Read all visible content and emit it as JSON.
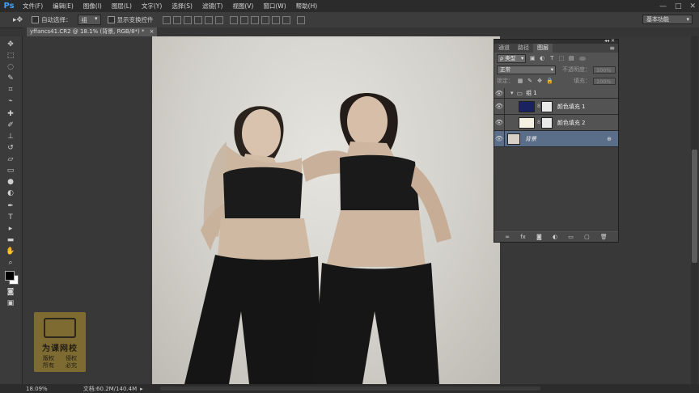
{
  "app": {
    "logo": "Ps"
  },
  "menu": [
    "文件(F)",
    "编辑(E)",
    "图像(I)",
    "图层(L)",
    "文字(Y)",
    "选择(S)",
    "滤镜(T)",
    "视图(V)",
    "窗口(W)",
    "帮助(H)"
  ],
  "window_controls": {
    "minimize": "—",
    "maximize": "□",
    "close": "✕"
  },
  "options": {
    "auto_select_label": "自动选择：",
    "auto_select_value": "组",
    "show_transform_label": "显示变换控件",
    "workspace": "基本功能"
  },
  "document": {
    "tab": "yffancs41.CR2 @ 18.1% (背景, RGB/8*) *",
    "close": "×"
  },
  "status": {
    "zoom": "18.09%",
    "doc_info": "文档:60.2M/140.4M"
  },
  "layers_panel": {
    "tabs": [
      "通道",
      "路径",
      "图层"
    ],
    "active_tab": "图层",
    "menu_icon": "≡",
    "filter_kind": "ρ 类型",
    "blend_mode": "正常",
    "opacity_label": "不透明度：",
    "opacity_value": "100%",
    "lock_label": "锁定：",
    "fill_label": "填充：",
    "fill_value": "100%",
    "layers": [
      {
        "name": "组 1",
        "type": "group"
      },
      {
        "name": "颜色填充 1",
        "type": "fill",
        "swatch": "#1a2360"
      },
      {
        "name": "颜色填充 2",
        "type": "fill",
        "swatch": "#f4f0e2"
      },
      {
        "name": "背景",
        "type": "background",
        "selected": true
      }
    ],
    "bottom_icons": [
      "link-icon",
      "fx-icon",
      "mask-icon",
      "adjustment-icon",
      "folder-icon",
      "new-layer-icon",
      "trash-icon"
    ]
  },
  "watermark": {
    "title": "为课网校",
    "left_text": "版权 所有",
    "right_text": "侵权 必究"
  },
  "colors": {
    "selected_layer": "#5b6e89",
    "fill1": "#1a2360",
    "fill2": "#f4f0e2",
    "accent": "#3fa0ff"
  }
}
